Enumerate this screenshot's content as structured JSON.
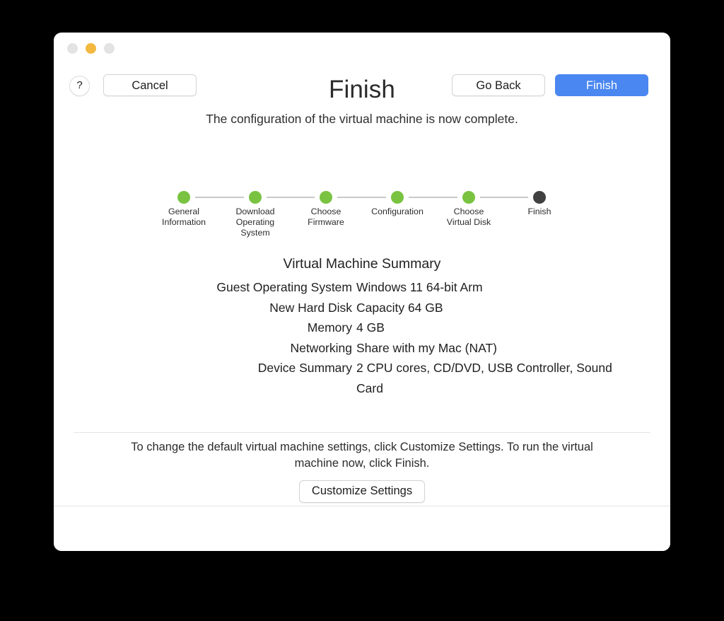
{
  "window": {
    "traffic_lights": [
      {
        "name": "close",
        "color": "#e3e3e3"
      },
      {
        "name": "minimize",
        "color": "#f2b840"
      },
      {
        "name": "zoom",
        "color": "#e3e3e3"
      }
    ]
  },
  "header": {
    "title": "Finish",
    "subtitle": "The configuration of the virtual machine is now complete."
  },
  "stepper": {
    "done_color": "#79c341",
    "current_color": "#414141",
    "connector_color": "#c9c9c9",
    "steps": [
      {
        "label": "General\nInformation",
        "state": "done"
      },
      {
        "label": "Download\nOperating\nSystem",
        "state": "done"
      },
      {
        "label": "Choose\nFirmware",
        "state": "done"
      },
      {
        "label": "Configuration",
        "state": "done"
      },
      {
        "label": "Choose\nVirtual Disk",
        "state": "done"
      },
      {
        "label": "Finish",
        "state": "current"
      }
    ]
  },
  "summary": {
    "title": "Virtual Machine Summary",
    "rows": [
      {
        "label": "Guest Operating System",
        "value": "Windows 11 64-bit Arm"
      },
      {
        "label": "New Hard Disk",
        "value": "Capacity 64 GB"
      },
      {
        "label": "Memory",
        "value": "4 GB"
      },
      {
        "label": "Networking",
        "value": "Share with my Mac (NAT)"
      },
      {
        "label": "Device Summary",
        "value": "2 CPU cores, CD/DVD, USB Controller, Sound Card"
      }
    ]
  },
  "customize": {
    "help_text": "To change the default virtual machine settings, click Customize Settings. To run the virtual machine now, click Finish.",
    "button_label": "Customize Settings"
  },
  "bottom_bar": {
    "help_icon": "?",
    "cancel_label": "Cancel",
    "go_back_label": "Go Back",
    "finish_label": "Finish",
    "finish_accent_color": "#4a87f0"
  }
}
